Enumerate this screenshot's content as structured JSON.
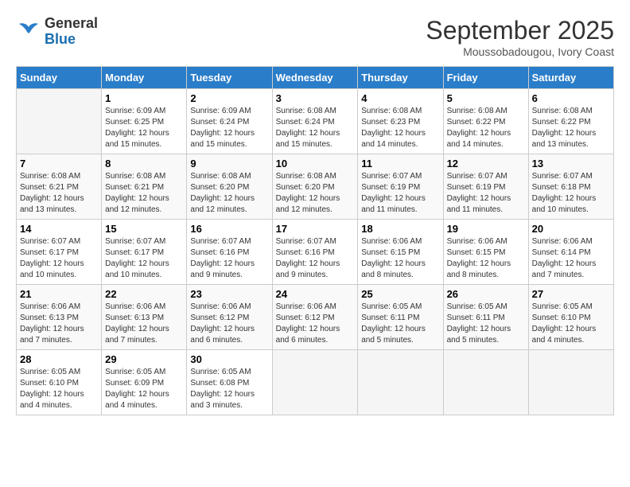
{
  "header": {
    "logo_general": "General",
    "logo_blue": "Blue",
    "month": "September 2025",
    "location": "Moussobadougou, Ivory Coast"
  },
  "days_of_week": [
    "Sunday",
    "Monday",
    "Tuesday",
    "Wednesday",
    "Thursday",
    "Friday",
    "Saturday"
  ],
  "weeks": [
    [
      {
        "day": "",
        "info": ""
      },
      {
        "day": "1",
        "info": "Sunrise: 6:09 AM\nSunset: 6:25 PM\nDaylight: 12 hours\nand 15 minutes."
      },
      {
        "day": "2",
        "info": "Sunrise: 6:09 AM\nSunset: 6:24 PM\nDaylight: 12 hours\nand 15 minutes."
      },
      {
        "day": "3",
        "info": "Sunrise: 6:08 AM\nSunset: 6:24 PM\nDaylight: 12 hours\nand 15 minutes."
      },
      {
        "day": "4",
        "info": "Sunrise: 6:08 AM\nSunset: 6:23 PM\nDaylight: 12 hours\nand 14 minutes."
      },
      {
        "day": "5",
        "info": "Sunrise: 6:08 AM\nSunset: 6:22 PM\nDaylight: 12 hours\nand 14 minutes."
      },
      {
        "day": "6",
        "info": "Sunrise: 6:08 AM\nSunset: 6:22 PM\nDaylight: 12 hours\nand 13 minutes."
      }
    ],
    [
      {
        "day": "7",
        "info": "Sunrise: 6:08 AM\nSunset: 6:21 PM\nDaylight: 12 hours\nand 13 minutes."
      },
      {
        "day": "8",
        "info": "Sunrise: 6:08 AM\nSunset: 6:21 PM\nDaylight: 12 hours\nand 12 minutes."
      },
      {
        "day": "9",
        "info": "Sunrise: 6:08 AM\nSunset: 6:20 PM\nDaylight: 12 hours\nand 12 minutes."
      },
      {
        "day": "10",
        "info": "Sunrise: 6:08 AM\nSunset: 6:20 PM\nDaylight: 12 hours\nand 12 minutes."
      },
      {
        "day": "11",
        "info": "Sunrise: 6:07 AM\nSunset: 6:19 PM\nDaylight: 12 hours\nand 11 minutes."
      },
      {
        "day": "12",
        "info": "Sunrise: 6:07 AM\nSunset: 6:19 PM\nDaylight: 12 hours\nand 11 minutes."
      },
      {
        "day": "13",
        "info": "Sunrise: 6:07 AM\nSunset: 6:18 PM\nDaylight: 12 hours\nand 10 minutes."
      }
    ],
    [
      {
        "day": "14",
        "info": "Sunrise: 6:07 AM\nSunset: 6:17 PM\nDaylight: 12 hours\nand 10 minutes."
      },
      {
        "day": "15",
        "info": "Sunrise: 6:07 AM\nSunset: 6:17 PM\nDaylight: 12 hours\nand 10 minutes."
      },
      {
        "day": "16",
        "info": "Sunrise: 6:07 AM\nSunset: 6:16 PM\nDaylight: 12 hours\nand 9 minutes."
      },
      {
        "day": "17",
        "info": "Sunrise: 6:07 AM\nSunset: 6:16 PM\nDaylight: 12 hours\nand 9 minutes."
      },
      {
        "day": "18",
        "info": "Sunrise: 6:06 AM\nSunset: 6:15 PM\nDaylight: 12 hours\nand 8 minutes."
      },
      {
        "day": "19",
        "info": "Sunrise: 6:06 AM\nSunset: 6:15 PM\nDaylight: 12 hours\nand 8 minutes."
      },
      {
        "day": "20",
        "info": "Sunrise: 6:06 AM\nSunset: 6:14 PM\nDaylight: 12 hours\nand 7 minutes."
      }
    ],
    [
      {
        "day": "21",
        "info": "Sunrise: 6:06 AM\nSunset: 6:13 PM\nDaylight: 12 hours\nand 7 minutes."
      },
      {
        "day": "22",
        "info": "Sunrise: 6:06 AM\nSunset: 6:13 PM\nDaylight: 12 hours\nand 7 minutes."
      },
      {
        "day": "23",
        "info": "Sunrise: 6:06 AM\nSunset: 6:12 PM\nDaylight: 12 hours\nand 6 minutes."
      },
      {
        "day": "24",
        "info": "Sunrise: 6:06 AM\nSunset: 6:12 PM\nDaylight: 12 hours\nand 6 minutes."
      },
      {
        "day": "25",
        "info": "Sunrise: 6:05 AM\nSunset: 6:11 PM\nDaylight: 12 hours\nand 5 minutes."
      },
      {
        "day": "26",
        "info": "Sunrise: 6:05 AM\nSunset: 6:11 PM\nDaylight: 12 hours\nand 5 minutes."
      },
      {
        "day": "27",
        "info": "Sunrise: 6:05 AM\nSunset: 6:10 PM\nDaylight: 12 hours\nand 4 minutes."
      }
    ],
    [
      {
        "day": "28",
        "info": "Sunrise: 6:05 AM\nSunset: 6:10 PM\nDaylight: 12 hours\nand 4 minutes."
      },
      {
        "day": "29",
        "info": "Sunrise: 6:05 AM\nSunset: 6:09 PM\nDaylight: 12 hours\nand 4 minutes."
      },
      {
        "day": "30",
        "info": "Sunrise: 6:05 AM\nSunset: 6:08 PM\nDaylight: 12 hours\nand 3 minutes."
      },
      {
        "day": "",
        "info": ""
      },
      {
        "day": "",
        "info": ""
      },
      {
        "day": "",
        "info": ""
      },
      {
        "day": "",
        "info": ""
      }
    ]
  ]
}
